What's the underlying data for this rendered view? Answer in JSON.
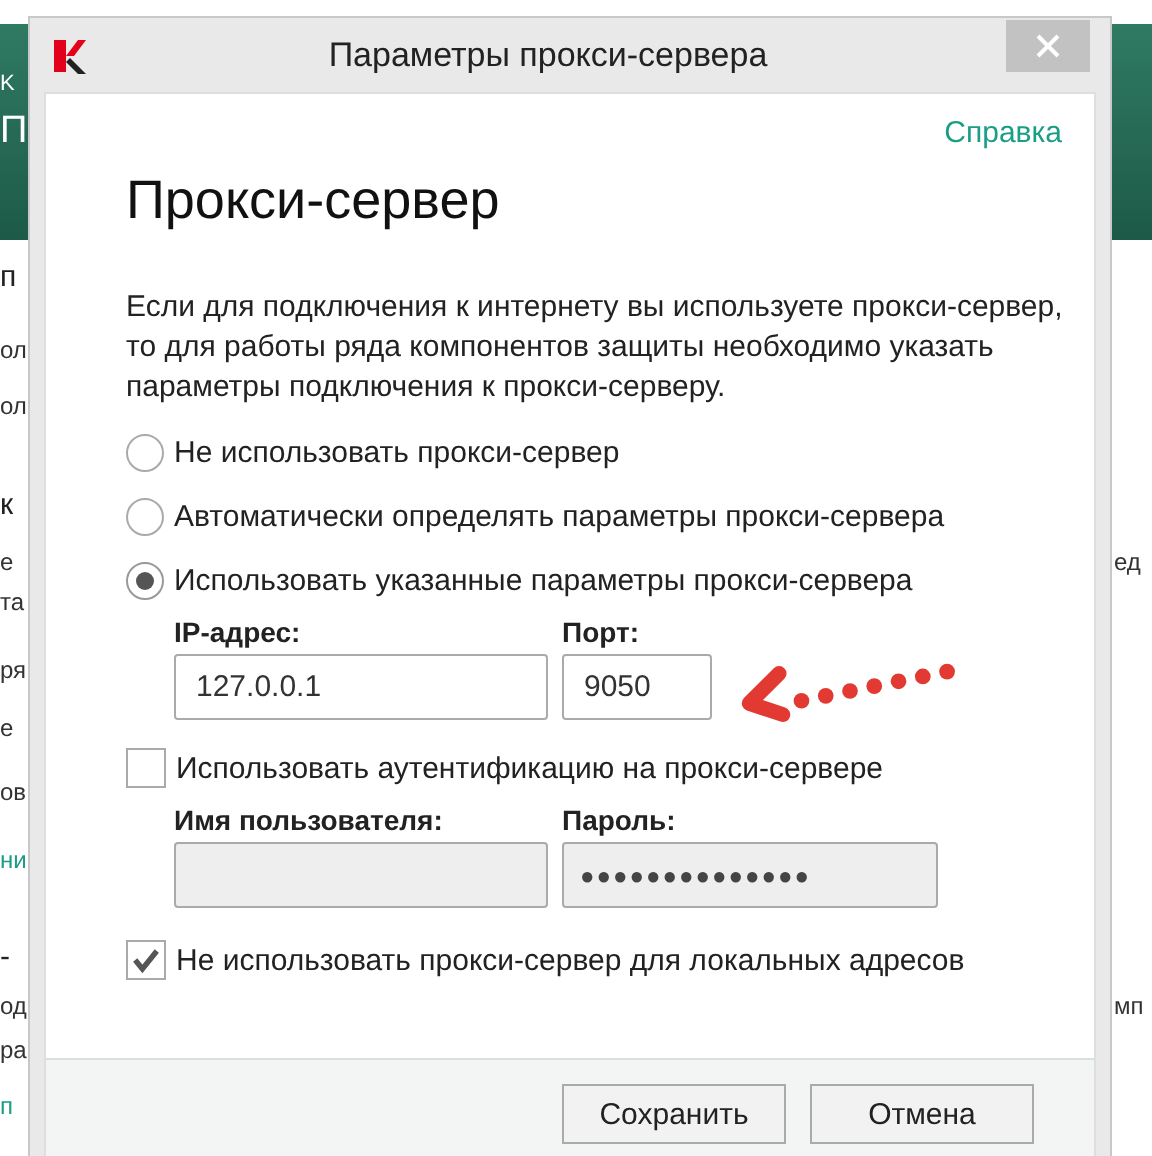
{
  "background_window": {
    "left_fragments": [
      {
        "text": "K",
        "kind": "header-small"
      },
      {
        "text": "П",
        "kind": "header-title"
      },
      {
        "text": "п",
        "kind": "heading"
      },
      {
        "text": "ол",
        "kind": "text"
      },
      {
        "text": "ол",
        "kind": "text"
      },
      {
        "text": "к",
        "kind": "heading"
      },
      {
        "text": "е",
        "kind": "text"
      },
      {
        "text": "та",
        "kind": "text"
      },
      {
        "text": "ря",
        "kind": "text"
      },
      {
        "text": "е",
        "kind": "text"
      },
      {
        "text": "ов",
        "kind": "text"
      },
      {
        "text": "ни",
        "kind": "link"
      },
      {
        "text": "-",
        "kind": "heading"
      },
      {
        "text": "од",
        "kind": "text"
      },
      {
        "text": "ра",
        "kind": "text"
      },
      {
        "text": "п",
        "kind": "link"
      }
    ],
    "right_fragments": [
      {
        "text": "ед"
      },
      {
        "text": "мп"
      }
    ]
  },
  "window": {
    "title": "Параметры прокси-сервера"
  },
  "help_link": "Справка",
  "heading": "Прокси-сервер",
  "description": "Если для подключения к интернету вы используете прокси-сервер, то для работы ряда компонентов защиты необходимо указать параметры подключения к прокси-серверу.",
  "proxy_modes": [
    {
      "label": "Не использовать прокси-сервер",
      "selected": false
    },
    {
      "label": "Автоматически определять параметры прокси-сервера",
      "selected": false
    },
    {
      "label": "Использовать указанные параметры прокси-сервера",
      "selected": true
    }
  ],
  "address": {
    "label": "IP-адрес:",
    "value": "127.0.0.1"
  },
  "port": {
    "label": "Порт:",
    "value": "9050"
  },
  "authentication": {
    "label": "Использовать аутентификацию на прокси-сервере",
    "checked": false
  },
  "username": {
    "label": "Имя пользователя:",
    "disabled": true
  },
  "password": {
    "label": "Пароль:",
    "value": "●●●●●●●●●●●●●●",
    "disabled": true
  },
  "bypass_local": {
    "label": "Не использовать прокси-сервер для локальных адресов",
    "checked": true
  },
  "buttons": [
    "Сохранить",
    "Отмена"
  ]
}
